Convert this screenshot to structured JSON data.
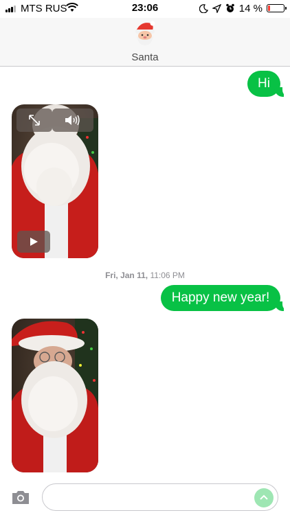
{
  "status_bar": {
    "carrier": "MTS RUS",
    "time": "23:06",
    "battery_percent": "14 %",
    "battery_level": 0.14
  },
  "header": {
    "contact_name": "Santa",
    "avatar_icon": "santa-emoji-icon"
  },
  "messages": [
    {
      "type": "outgoing-text",
      "text": "Hi"
    },
    {
      "type": "incoming-video",
      "controls": [
        "expand-icon",
        "speaker-icon",
        "play-icon"
      ]
    },
    {
      "type": "outgoing-text",
      "text": "Happy new year!"
    },
    {
      "type": "incoming-video"
    }
  ],
  "timestamp": {
    "day": "Fri, Jan 11,",
    "time": " 11:06 PM"
  },
  "input": {
    "placeholder": "",
    "send_icon": "arrow-up-icon",
    "camera_icon": "camera-icon"
  },
  "colors": {
    "bubble": "#08c145",
    "battery_low": "#ff3b30",
    "header_bg": "#f7f7f7"
  }
}
